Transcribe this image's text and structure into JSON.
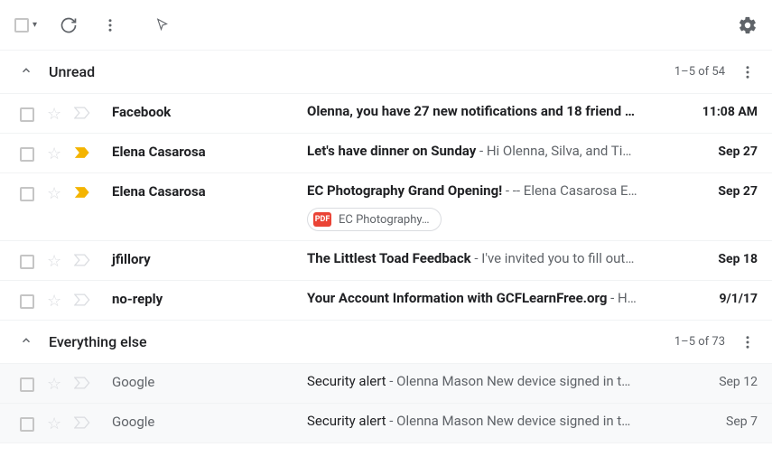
{
  "sections": {
    "unread": {
      "title": "Unread",
      "count": "1–5 of 54"
    },
    "everything": {
      "title": "Everything else",
      "count": "1–5 of 73"
    }
  },
  "emails": {
    "unread": [
      {
        "sender": "Facebook",
        "subject": "Olenna, you have 27 new notifications and 18 friend …",
        "snippet": "",
        "date": "11:08 AM",
        "important": false
      },
      {
        "sender": "Elena Casarosa",
        "subject": "Let's have dinner on Sunday",
        "snippet": " - Hi Olenna, Silva, and Ti…",
        "date": "Sep 27",
        "important": true
      },
      {
        "sender": "Elena Casarosa",
        "subject": "EC Photography Grand Opening!",
        "snippet": " - -- Elena Casarosa E…",
        "date": "Sep 27",
        "important": true,
        "attachment": "EC Photography…"
      },
      {
        "sender": "jfillory",
        "subject": "The Littlest Toad Feedback",
        "snippet": " - I've invited you to fill out…",
        "date": "Sep 18",
        "important": false
      },
      {
        "sender": "no-reply",
        "subject": "Your Account Information with GCFLearnFree.org",
        "snippet": " - H…",
        "date": "9/1/17",
        "important": false
      }
    ],
    "everything": [
      {
        "sender": "Google",
        "subject": "Security alert",
        "snippet": " - Olenna Mason New device signed in t…",
        "date": "Sep 12"
      },
      {
        "sender": "Google",
        "subject": "Security alert",
        "snippet": " - Olenna Mason New device signed in t…",
        "date": "Sep 7"
      }
    ]
  },
  "pdf_label": "PDF"
}
